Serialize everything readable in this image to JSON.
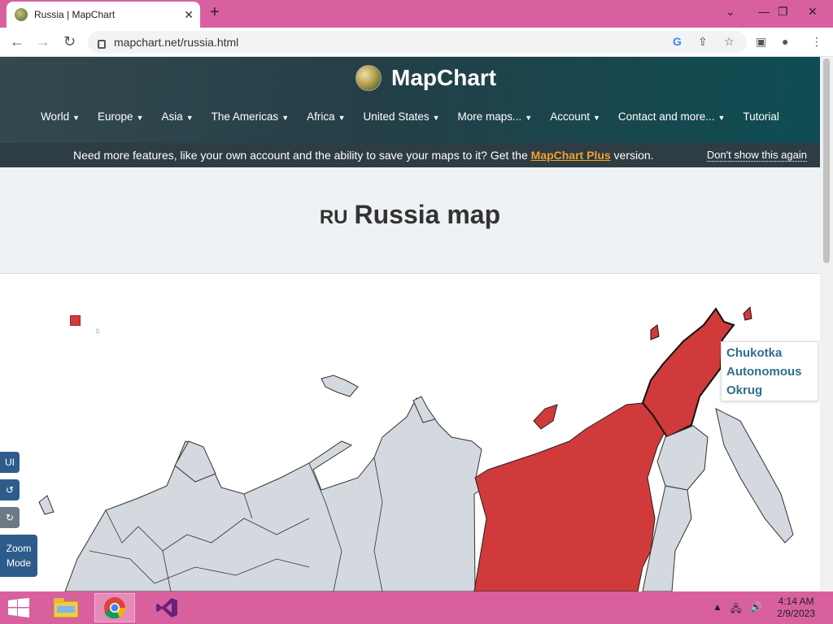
{
  "browser": {
    "tab_title": "Russia | MapChart",
    "url": "mapchart.net/russia.html"
  },
  "site": {
    "brand": "MapChart",
    "nav": [
      "World",
      "Europe",
      "Asia",
      "The Americas",
      "Africa",
      "United States",
      "More maps...",
      "Account",
      "Contact and more...",
      "Tutorial"
    ],
    "promo": {
      "before": "Need more features, like your own account and the ability to save your maps to it? Get the ",
      "link": "MapChart Plus",
      "after": " version.",
      "dismiss": "Don't show this again"
    },
    "title_code": "RU",
    "title": "Russia map"
  },
  "map": {
    "tooltip_line1": "Chukotka",
    "tooltip_line2": "Autonomous",
    "tooltip_line3": "Okrug",
    "selected_color": "#d03a3a",
    "default_color": "#d3d9de"
  },
  "controls": {
    "ui": "UI",
    "zoom_line1": "Zoom",
    "zoom_line2": "Mode"
  },
  "taskbar": {
    "time": "4:14 AM",
    "date": "2/9/2023"
  }
}
